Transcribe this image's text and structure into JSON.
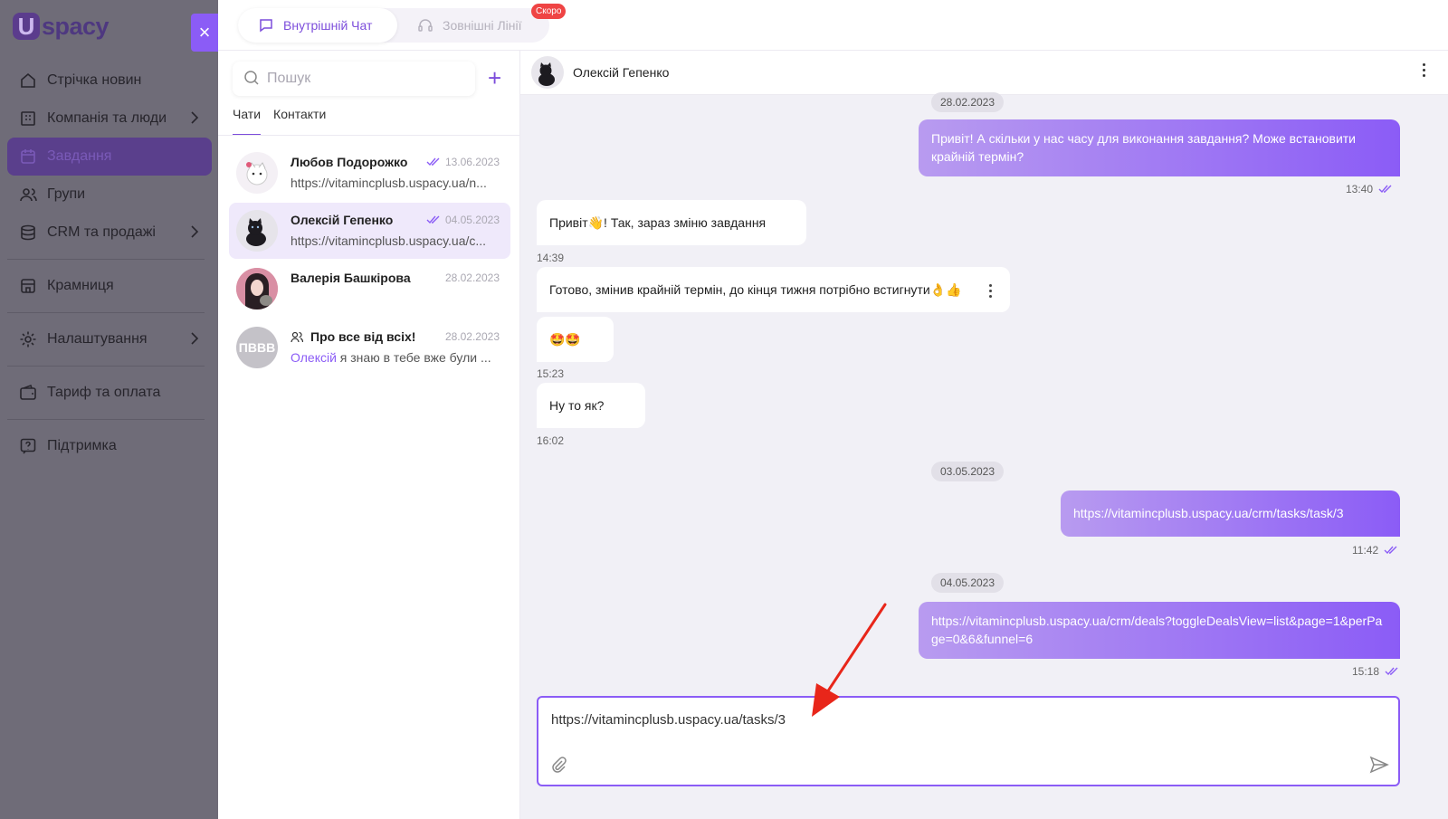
{
  "brand": {
    "logo_mark": "U",
    "logo_text": "spacy"
  },
  "sidebar": {
    "close_label": "×",
    "items": [
      {
        "label": "Стрічка новин",
        "icon": "home-icon"
      },
      {
        "label": "Компанія та люди",
        "icon": "building-icon",
        "has_chevron": true
      },
      {
        "label": "Завдання",
        "icon": "calendar-icon",
        "active": true
      },
      {
        "label": "Групи",
        "icon": "users-icon"
      },
      {
        "label": "CRM та продажі",
        "icon": "database-icon",
        "has_chevron": true
      },
      {
        "label": "Крамниця",
        "icon": "store-icon"
      },
      {
        "label": "Налаштування",
        "icon": "gear-icon",
        "has_chevron": true
      },
      {
        "label": "Тариф та оплата",
        "icon": "wallet-icon"
      },
      {
        "label": "Підтримка",
        "icon": "help-icon"
      }
    ]
  },
  "top_tabs": {
    "internal": "Внутрішній Чат",
    "external": "Зовнішні Лінії",
    "soon_badge": "Скоро"
  },
  "chat_list": {
    "search_placeholder": "Пошук",
    "add_label": "+",
    "tabs": [
      "Чати",
      "Контакти"
    ],
    "items": [
      {
        "name": "Любов Подорожко",
        "date": "13.06.2023",
        "preview": "https://vitamincplusb.uspacy.ua/n...",
        "read": true
      },
      {
        "name": "Олексій Гепенко",
        "date": "04.05.2023",
        "preview": "https://vitamincplusb.uspacy.ua/c...",
        "read": true,
        "selected": true
      },
      {
        "name": "Валерія Башкірова",
        "date": "28.02.2023",
        "preview": ""
      },
      {
        "name": "Про все від всіх!",
        "date": "28.02.2023",
        "initials": "ПВВВ",
        "sender": "Олексій",
        "preview": " я знаю в тебе вже були ..."
      }
    ]
  },
  "conversation": {
    "contact_name": "Олексій Гепенко",
    "dates": [
      "28.02.2023",
      "03.05.2023",
      "04.05.2023"
    ],
    "messages": [
      {
        "dir": "out",
        "text": "Привіт! А скільки у нас часу для виконання завдання? Може встановити крайній термін?",
        "time": "13:40"
      },
      {
        "dir": "in",
        "text": "Привіт👋! Так, зараз зміню завдання",
        "time": "14:39"
      },
      {
        "dir": "in",
        "text": "Готово, змінив крайній термін, до кінця тижня потрібно встигнути👌👍",
        "time": ""
      },
      {
        "dir": "in",
        "text": "🤩🤩",
        "time": "15:23"
      },
      {
        "dir": "in",
        "text": "Ну то як?",
        "time": "16:02"
      },
      {
        "dir": "out",
        "text": "https://vitamincplusb.uspacy.ua/crm/tasks/task/3",
        "time": "11:42"
      },
      {
        "dir": "out",
        "text": "https://vitamincplusb.uspacy.ua/crm/deals?toggleDealsView=list&page=1&perPage=0&6&funnel=6",
        "time": "15:18"
      }
    ],
    "composer_value": "https://vitamincplusb.uspacy.ua/tasks/3"
  },
  "colors": {
    "accent": "#8b5cf6",
    "sidebar_bg": "#6f6c78",
    "conv_bg": "#f1f0f6",
    "badge": "#ef4444"
  }
}
